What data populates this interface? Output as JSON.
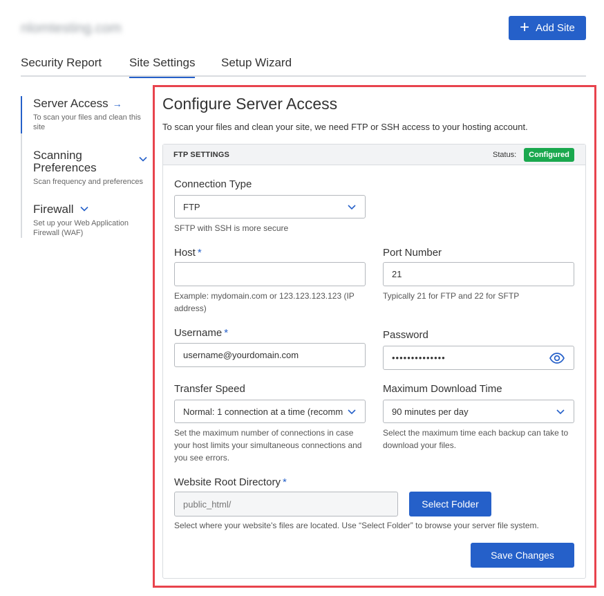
{
  "header": {
    "site_name": "nlomtesting.com",
    "add_site_label": "Add Site",
    "add_site_icon": "plus-icon"
  },
  "tabs": [
    {
      "label": "Security Report",
      "active": false
    },
    {
      "label": "Site Settings",
      "active": true
    },
    {
      "label": "Setup Wizard",
      "active": false
    }
  ],
  "sidebar": {
    "items": [
      {
        "title": "Server Access",
        "desc": "To scan your files and clean this site",
        "icon": "arrow-right-icon",
        "active": true
      },
      {
        "title": "Scanning Preferences",
        "desc": "Scan frequency and preferences",
        "icon": "chevron-down-icon",
        "active": false
      },
      {
        "title": "Firewall",
        "desc": "Set up your Web Application Firewall (WAF)",
        "icon": "chevron-down-icon",
        "active": false
      }
    ]
  },
  "panel": {
    "title": "Configure Server Access",
    "description": "To scan your files and clean your site, we need FTP or SSH access to your hosting account.",
    "card_title": "FTP SETTINGS",
    "status_label": "Status:",
    "status_value": "Configured"
  },
  "form": {
    "connection_type": {
      "label": "Connection Type",
      "value": "FTP",
      "help": "SFTP with SSH is more secure"
    },
    "host": {
      "label": "Host",
      "required": "*",
      "value": "",
      "help": "Example: mydomain.com or 123.123.123.123 (IP address)"
    },
    "port": {
      "label": "Port Number",
      "value": "21",
      "help": "Typically 21 for FTP and 22 for SFTP"
    },
    "username": {
      "label": "Username",
      "required": "*",
      "value": "username@yourdomain.com"
    },
    "password": {
      "label": "Password",
      "value": "••••••••••••••",
      "icon": "eye-icon"
    },
    "transfer_speed": {
      "label": "Transfer Speed",
      "value": "Normal: 1 connection at a time (recomm",
      "help": "Set the maximum number of connections in case your host limits your simultaneous connections and you see errors."
    },
    "max_download_time": {
      "label": "Maximum Download Time",
      "value": "90 minutes per day",
      "help": "Select the maximum time each backup can take to download your files."
    },
    "root_directory": {
      "label": "Website Root Directory",
      "required": "*",
      "placeholder": "public_html/",
      "help": "Select where your website's files are located. Use “Select Folder” to browse your server file system."
    },
    "select_folder_label": "Select Folder",
    "save_label": "Save Changes"
  },
  "colors": {
    "accent": "#2560c9",
    "status_green": "#1aa84e",
    "highlight_outline": "#e8434d"
  }
}
